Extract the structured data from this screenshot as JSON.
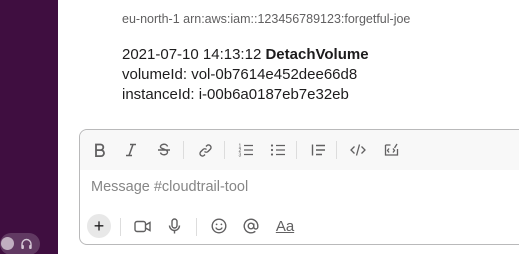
{
  "message": {
    "arn_line": "eu-north-1 arn:aws:iam::123456789123:forgetful-joe",
    "timestamp": "2021-07-10 14:13:12",
    "event_name": "DetachVolume",
    "volume_line": "volumeId: vol-0b7614e452dee66d8",
    "instance_line": "instanceId: i-00b6a0187eb7e32eb"
  },
  "composer": {
    "placeholder": "Message #cloudtrail-tool",
    "formatting_toolbar": [
      "bold-icon",
      "italic-icon",
      "strikethrough-icon",
      "link-icon",
      "ordered-list-icon",
      "bulleted-list-icon",
      "blockquote-icon",
      "code-icon",
      "code-block-icon"
    ],
    "bottom_toolbar": [
      "plus-icon",
      "video-icon",
      "microphone-icon",
      "emoji-icon",
      "mention-icon",
      "text-format-icon"
    ],
    "format_label": "Aa",
    "plus_label": "+"
  },
  "colors": {
    "sidebar": "#3f0e40",
    "text": "#1d1c1d",
    "muted_text": "#616061",
    "placeholder": "#868686",
    "composer_border": "#b9b9ba"
  }
}
